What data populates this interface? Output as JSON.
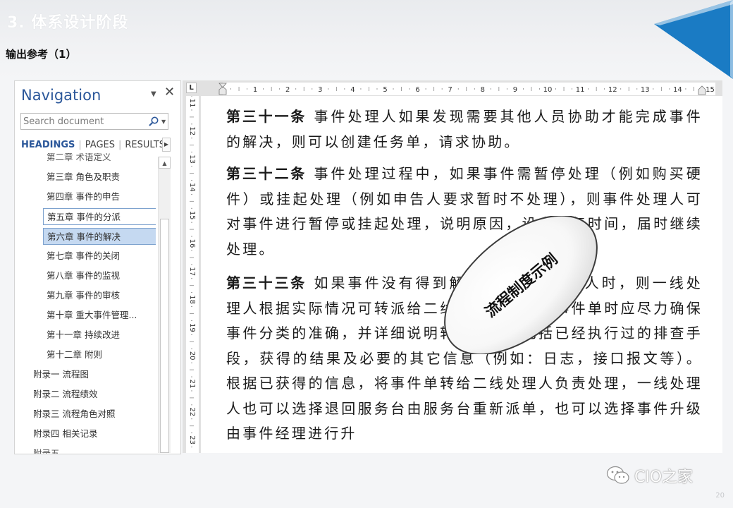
{
  "slide": {
    "title": "3. 体系设计阶段",
    "subtitle": "输出参考（1）",
    "page_number": "20",
    "watermark_text": "CIO之家",
    "accent_color": "#1a7bc4"
  },
  "navigation": {
    "title": "Navigation",
    "search_placeholder": "Search document",
    "tabs": [
      "HEADINGS",
      "PAGES",
      "RESULTS"
    ],
    "headings": [
      {
        "label": "第二章 术语定义",
        "level": 2,
        "state": "partial"
      },
      {
        "label": "第三章 角色及职责",
        "level": 2
      },
      {
        "label": "第四章 事件的申告",
        "level": 2
      },
      {
        "label": "第五章 事件的分派",
        "level": 2,
        "state": "framed"
      },
      {
        "label": "第六章 事件的解决",
        "level": 2,
        "state": "selected"
      },
      {
        "label": "第七章 事件的关闭",
        "level": 2
      },
      {
        "label": "第八章 事件的监视",
        "level": 2
      },
      {
        "label": "第九章 事件的审核",
        "level": 2
      },
      {
        "label": "第十章 重大事件管理...",
        "level": 2
      },
      {
        "label": "第十一章 持续改进",
        "level": 2
      },
      {
        "label": "第十二章 附则",
        "level": 2
      },
      {
        "label": "附录一 流程图",
        "level": 1
      },
      {
        "label": "附录二 流程绩效",
        "level": 1
      },
      {
        "label": "附录三 流程角色对照",
        "level": 1
      },
      {
        "label": "附录四 相关记录",
        "level": 1
      },
      {
        "label": "附录五 ...",
        "level": 1,
        "state": "partial"
      }
    ]
  },
  "ruler": {
    "horizontal": [
      "1",
      "2",
      "3",
      "4",
      "5",
      "6",
      "7",
      "8",
      "9",
      "10",
      "11",
      "12",
      "13",
      "14",
      "15"
    ],
    "vertical": [
      "11",
      "12",
      "13",
      "14",
      "15",
      "16",
      "17",
      "18",
      "19",
      "20",
      "21",
      "22",
      "23",
      "24"
    ],
    "corner_label": "L"
  },
  "document": {
    "paragraphs": [
      {
        "lead": "第三十一条",
        "text": " 事件处理人如果发现需要其他人员协助才能完成事件的解决，则可以创建任务单，请求协助。"
      },
      {
        "lead": "第三十二条",
        "text": " 事件处理过程中，如果事件需暂停处理（例如购买硬件）或挂起处理（例如申告人要求暂时不处理），则事件处理人可对事件进行暂停或挂起处理，说明原因，设定恢复时间，届时继续处理。"
      },
      {
        "lead": "第三十三条",
        "text": " 如果事件没有得到解决需要更换处理人时，则一线处理人根据实际情况可转派给二线处理，在转派事件单时应尽力确保事件分类的准确，并详细说明转单理由，包括已经执行过的排查手段，获得的结果及必要的其它信息（例如：日志，接口报文等）。根据已获得的信息，将事件单转给二线处理人负责处理，一线处理人也可以选择退回服务台由服务台重新派单，也可以选择事件升级由事件经理进行升"
      }
    ]
  },
  "callout": {
    "label": "流程制度示例"
  }
}
